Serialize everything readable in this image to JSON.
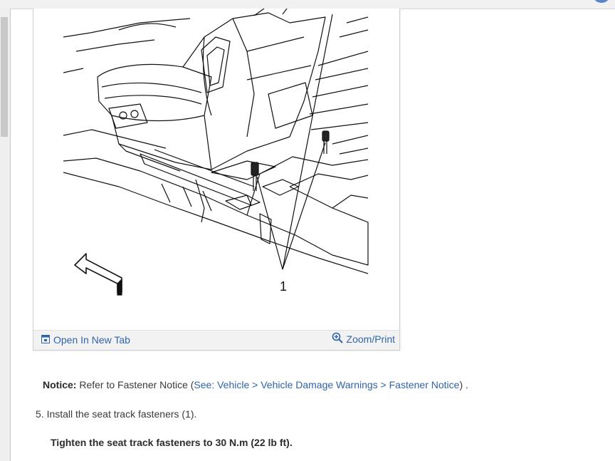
{
  "figure": {
    "callout_label": "1",
    "open_new_tab_label": "Open In New Tab",
    "zoom_print_label": "Zoom/Print",
    "icons": {
      "open_tab": "new-tab-icon",
      "zoom": "zoom-in-icon",
      "direction": "front-arrow-icon"
    }
  },
  "notice": {
    "label": "Notice:",
    "text": "Refer to Fastener Notice",
    "open_paren": "(",
    "link_text": "See: Vehicle > Vehicle Damage Warnings > Fastener Notice",
    "close": ") ."
  },
  "step": {
    "text": "5. Install the seat track fasteners (1)."
  },
  "spec": {
    "text": "Tighten the seat track fasteners to 30 N.m (22 lb ft)."
  },
  "colors": {
    "link": "#2f64a9",
    "footer": "#f2f2f2",
    "text": "#3a3a3a"
  }
}
